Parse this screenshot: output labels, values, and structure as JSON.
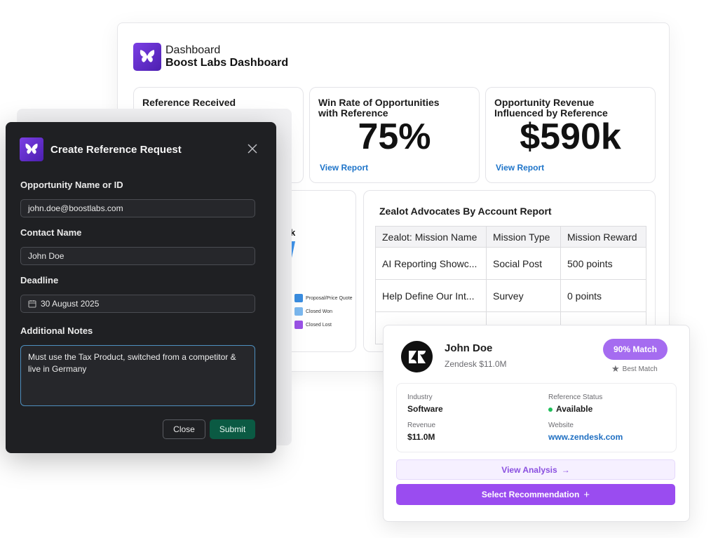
{
  "dashboard": {
    "subtitle": "Dashboard",
    "title": "Boost Labs Dashboard",
    "cards": [
      {
        "title": "Reference Received"
      },
      {
        "title": "Win Rate of Opportunities with Reference",
        "value": "75%",
        "link": "View Report"
      },
      {
        "title": "Opportunity Revenue Influenced by Reference",
        "value": "$590k",
        "link": "View Report"
      }
    ],
    "funnel": {
      "partial_title": "k",
      "legend": [
        {
          "label": "Proposal/Price Quote",
          "color": "#3a8de0"
        },
        {
          "label": "Closed Won",
          "color": "#7bb8ef"
        },
        {
          "label": "Closed Lost",
          "color": "#9a52e6"
        }
      ]
    },
    "advocates": {
      "title": "Zealot Advocates By Account Report",
      "columns": [
        "Zealot: Mission Name",
        "Mission Type",
        "Mission Reward"
      ],
      "rows": [
        [
          "AI Reporting Showc...",
          "Social Post",
          "500 points"
        ],
        [
          "Help Define Our Int...",
          "Survey",
          "0 points"
        ]
      ]
    }
  },
  "modal": {
    "title": "Create Reference Request",
    "fields": {
      "opportunity_label": "Opportunity Name or ID",
      "opportunity_value": "john.doe@boostlabs.com",
      "contact_label": "Contact Name",
      "contact_value": "John Doe",
      "deadline_label": "Deadline",
      "deadline_value": "30 August 2025",
      "notes_label": "Additional Notes",
      "notes_value": "Must use the Tax Product, switched from a competitor & live in Germany"
    },
    "close_label": "Close",
    "submit_label": "Submit"
  },
  "recommendation": {
    "name": "John Doe",
    "company": "Zendesk $11.0M",
    "match": "90% Match",
    "best_match": "Best Match",
    "industry_label": "Industry",
    "industry_value": "Software",
    "status_label": "Reference Status",
    "status_value": "Available",
    "revenue_label": "Revenue",
    "revenue_value": "$11.0M",
    "website_label": "Website",
    "website_value": "www.zendesk.com",
    "view_analysis": "View Analysis",
    "view_analysis_icon": "→",
    "select": "Select Recommendation",
    "select_icon": "+"
  },
  "colors": {
    "brand": "#6a2fd6",
    "submit": "#0b5a43",
    "link": "#1e74c9",
    "match": "#a56cf0",
    "select": "#9a4cf0"
  },
  "icons": [
    "butterfly-logo-icon",
    "close-icon",
    "calendar-icon",
    "zendesk-logo-icon",
    "star-icon",
    "arrow-right-icon",
    "plus-icon"
  ]
}
